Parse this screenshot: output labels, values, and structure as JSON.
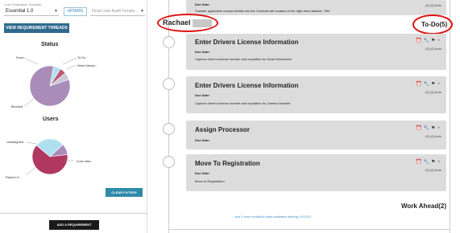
{
  "template": {
    "label": "Loan Origination Template",
    "selected": "Essential 1.0",
    "update_label": "UPDATE",
    "final_placeholder": "Final Loan Audit Templa..."
  },
  "view_button_label": "VIEW REQUIREMENT THREADS",
  "status_chart": {
    "title": "Status",
    "labels": {
      "done": "Done",
      "todo": "To Do",
      "work_ahead": "Work Ahead...",
      "blocked": "Blocked"
    }
  },
  "users_chart": {
    "title": "Users",
    "labels": {
      "unassigned": "Unassigned",
      "rachel": "Rachel H...",
      "alex": "Kuon Alex"
    }
  },
  "chart_data": [
    {
      "type": "pie",
      "title": "Status",
      "categories": [
        "Done",
        "To Do",
        "Work Ahead...",
        "Blocked"
      ],
      "values": [
        6,
        5,
        6,
        83
      ],
      "colors": [
        "#b0e0f0",
        "#c05577",
        "#c9c9d6",
        "#a98db8"
      ]
    },
    {
      "type": "pie",
      "title": "Users",
      "categories": [
        "Unassigned",
        "Rachel H...",
        "Kuon Alex"
      ],
      "values": [
        27,
        10,
        63
      ],
      "colors": [
        "#b0e0f0",
        "#a98db8",
        "#b03860"
      ]
    }
  ],
  "clear_filters_label": "CLEAR FILTERS",
  "add_requirement_label": "ADD A REQUIREMENT",
  "top_card": {
    "due_label": "Due Date:",
    "desc": "Transfer applicable contact details into the Contacts tab located on the right-hand taskbar. Title"
  },
  "user_name": "Rachael",
  "todo_label": "To-Do(5)",
  "tasks": [
    {
      "title": "Enter Drivers License Information",
      "due_label": "Due Date:",
      "desc": "Capture driver's license number and expiration for Dean Winchester",
      "meta": "(0)  (0)  Auto"
    },
    {
      "title": "Enter Drivers License Information",
      "due_label": "Due Date:",
      "desc": "Capture driver's license number and expiration for Joanna Harvelle",
      "meta": "(0)  (0)  Auto"
    },
    {
      "title": "Assign Processor",
      "due_label": "Due Date:",
      "desc": "",
      "meta": "(0)  (0)  Auto"
    },
    {
      "title": "Move To Registration",
      "due_label": "Due Date:",
      "desc": "Move to Registration",
      "meta": "(0)  (0)  Auto"
    }
  ],
  "top_meta": "(0)  (0)  Auto",
  "work_ahead_label": "Work Ahead(2)",
  "more_link": "... and 2 more workflow tasks available starting 11/12/21",
  "icons": [
    "alarm-clock-icon",
    "wrench-icon",
    "flag-icon",
    "gauge-icon",
    "comment-icon",
    "document-icon"
  ]
}
